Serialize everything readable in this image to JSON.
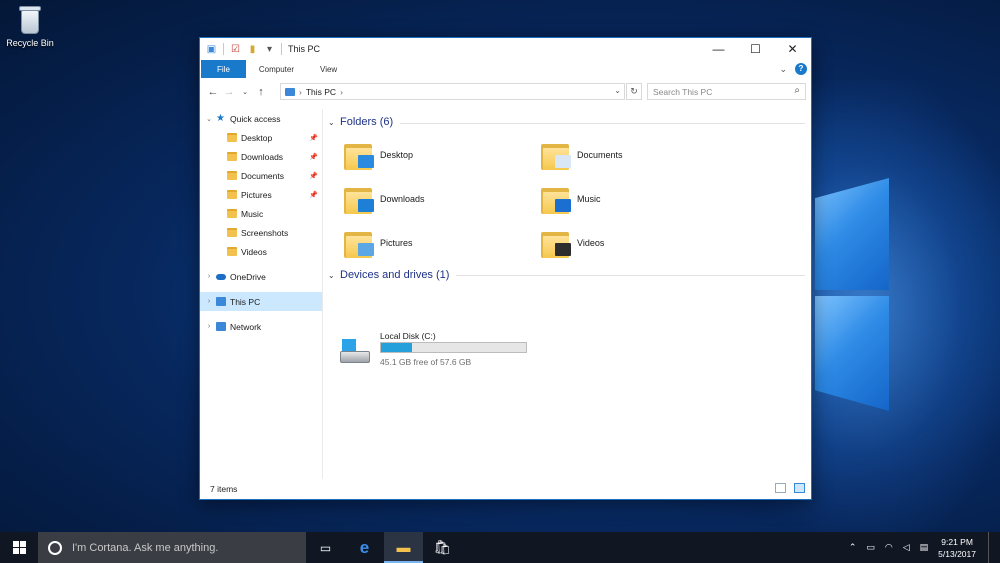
{
  "desktop": {
    "recycle_bin_label": "Recycle Bin"
  },
  "window": {
    "title": "This PC",
    "qat_icons": [
      "computer-icon",
      "properties-icon",
      "new-folder-icon",
      "customize-arrow-icon"
    ],
    "controls": {
      "minimize": "—",
      "maximize": "☐",
      "close": "✕"
    }
  },
  "ribbon": {
    "tabs": [
      "File",
      "Computer",
      "View"
    ],
    "help": "?"
  },
  "address": {
    "path": "This PC",
    "search_placeholder": "Search This PC"
  },
  "nav": {
    "quick_access": "Quick access",
    "quick_items": [
      {
        "label": "Desktop",
        "pinned": true
      },
      {
        "label": "Downloads",
        "pinned": true
      },
      {
        "label": "Documents",
        "pinned": true
      },
      {
        "label": "Pictures",
        "pinned": true
      },
      {
        "label": "Music",
        "pinned": false
      },
      {
        "label": "Screenshots",
        "pinned": false
      },
      {
        "label": "Videos",
        "pinned": false
      }
    ],
    "onedrive": "OneDrive",
    "this_pc": "This PC",
    "network": "Network"
  },
  "content": {
    "folders_header": "Folders (6)",
    "folders": [
      {
        "label": "Desktop",
        "icon": "desktop-folder-icon",
        "badge_color": "#2a8ae0"
      },
      {
        "label": "Documents",
        "icon": "documents-folder-icon",
        "badge_color": "#d9e7f5"
      },
      {
        "label": "Downloads",
        "icon": "downloads-folder-icon",
        "badge_color": "#1e7fd6"
      },
      {
        "label": "Music",
        "icon": "music-folder-icon",
        "badge_color": "#1a6fd1"
      },
      {
        "label": "Pictures",
        "icon": "pictures-folder-icon",
        "badge_color": "#5ba7e6"
      },
      {
        "label": "Videos",
        "icon": "videos-folder-icon",
        "badge_color": "#2d2d2d"
      }
    ],
    "devices_header": "Devices and drives (1)",
    "drive": {
      "name": "Local Disk (C:)",
      "free_text": "45.1 GB free of 57.6 GB",
      "used_fraction": 0.217
    }
  },
  "status": {
    "items": "7 items"
  },
  "taskbar": {
    "cortana_placeholder": "I'm Cortana. Ask me anything.",
    "time": "9:21 PM",
    "date": "5/13/2017"
  },
  "colors": {
    "accent": "#1979ca",
    "selection": "#cce8ff",
    "drive_bar": "#26a0da"
  }
}
